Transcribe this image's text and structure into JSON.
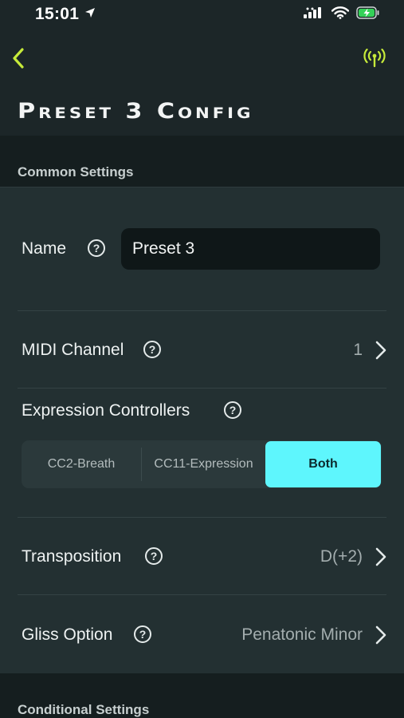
{
  "status_bar": {
    "time": "15:01",
    "location_icon": "location-arrow-icon",
    "signal_icon": "cellular-signal-icon",
    "wifi_icon": "wifi-icon",
    "battery_icon": "battery-charging-icon"
  },
  "nav": {
    "back_icon": "chevron-left-icon",
    "antenna_icon": "antenna-broadcast-icon",
    "accent_color": "#c6ea3a"
  },
  "page": {
    "title": "Preset 3 Config"
  },
  "sections": {
    "common": "Common Settings",
    "conditional": "Conditional Settings"
  },
  "name_row": {
    "label": "Name",
    "value": "Preset 3"
  },
  "midi_row": {
    "label": "MIDI Channel",
    "value": "1"
  },
  "expression": {
    "label": "Expression Controllers",
    "options": [
      "CC2-Breath",
      "CC11-Expression",
      "Both"
    ],
    "selected": "Both",
    "active_color": "#5ef6fd"
  },
  "transposition_row": {
    "label": "Transposition",
    "value": "D(+2)"
  },
  "gliss_row": {
    "label": "Gliss Option",
    "value": "Penatonic Minor"
  },
  "help_glyph": "?"
}
